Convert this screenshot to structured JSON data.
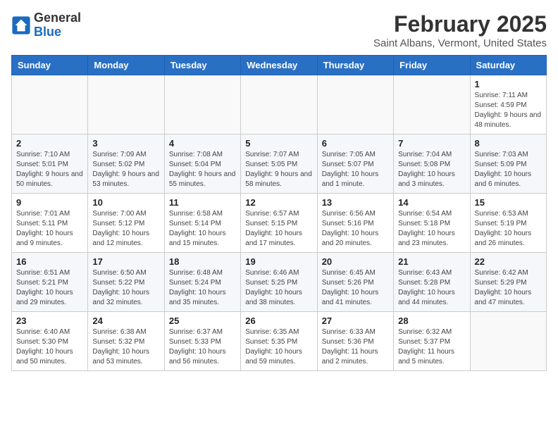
{
  "header": {
    "logo_general": "General",
    "logo_blue": "Blue",
    "title": "February 2025",
    "subtitle": "Saint Albans, Vermont, United States"
  },
  "weekdays": [
    "Sunday",
    "Monday",
    "Tuesday",
    "Wednesday",
    "Thursday",
    "Friday",
    "Saturday"
  ],
  "weeks": [
    [
      {
        "day": "",
        "info": ""
      },
      {
        "day": "",
        "info": ""
      },
      {
        "day": "",
        "info": ""
      },
      {
        "day": "",
        "info": ""
      },
      {
        "day": "",
        "info": ""
      },
      {
        "day": "",
        "info": ""
      },
      {
        "day": "1",
        "info": "Sunrise: 7:11 AM\nSunset: 4:59 PM\nDaylight: 9 hours and 48 minutes."
      }
    ],
    [
      {
        "day": "2",
        "info": "Sunrise: 7:10 AM\nSunset: 5:01 PM\nDaylight: 9 hours and 50 minutes."
      },
      {
        "day": "3",
        "info": "Sunrise: 7:09 AM\nSunset: 5:02 PM\nDaylight: 9 hours and 53 minutes."
      },
      {
        "day": "4",
        "info": "Sunrise: 7:08 AM\nSunset: 5:04 PM\nDaylight: 9 hours and 55 minutes."
      },
      {
        "day": "5",
        "info": "Sunrise: 7:07 AM\nSunset: 5:05 PM\nDaylight: 9 hours and 58 minutes."
      },
      {
        "day": "6",
        "info": "Sunrise: 7:05 AM\nSunset: 5:07 PM\nDaylight: 10 hours and 1 minute."
      },
      {
        "day": "7",
        "info": "Sunrise: 7:04 AM\nSunset: 5:08 PM\nDaylight: 10 hours and 3 minutes."
      },
      {
        "day": "8",
        "info": "Sunrise: 7:03 AM\nSunset: 5:09 PM\nDaylight: 10 hours and 6 minutes."
      }
    ],
    [
      {
        "day": "9",
        "info": "Sunrise: 7:01 AM\nSunset: 5:11 PM\nDaylight: 10 hours and 9 minutes."
      },
      {
        "day": "10",
        "info": "Sunrise: 7:00 AM\nSunset: 5:12 PM\nDaylight: 10 hours and 12 minutes."
      },
      {
        "day": "11",
        "info": "Sunrise: 6:58 AM\nSunset: 5:14 PM\nDaylight: 10 hours and 15 minutes."
      },
      {
        "day": "12",
        "info": "Sunrise: 6:57 AM\nSunset: 5:15 PM\nDaylight: 10 hours and 17 minutes."
      },
      {
        "day": "13",
        "info": "Sunrise: 6:56 AM\nSunset: 5:16 PM\nDaylight: 10 hours and 20 minutes."
      },
      {
        "day": "14",
        "info": "Sunrise: 6:54 AM\nSunset: 5:18 PM\nDaylight: 10 hours and 23 minutes."
      },
      {
        "day": "15",
        "info": "Sunrise: 6:53 AM\nSunset: 5:19 PM\nDaylight: 10 hours and 26 minutes."
      }
    ],
    [
      {
        "day": "16",
        "info": "Sunrise: 6:51 AM\nSunset: 5:21 PM\nDaylight: 10 hours and 29 minutes."
      },
      {
        "day": "17",
        "info": "Sunrise: 6:50 AM\nSunset: 5:22 PM\nDaylight: 10 hours and 32 minutes."
      },
      {
        "day": "18",
        "info": "Sunrise: 6:48 AM\nSunset: 5:24 PM\nDaylight: 10 hours and 35 minutes."
      },
      {
        "day": "19",
        "info": "Sunrise: 6:46 AM\nSunset: 5:25 PM\nDaylight: 10 hours and 38 minutes."
      },
      {
        "day": "20",
        "info": "Sunrise: 6:45 AM\nSunset: 5:26 PM\nDaylight: 10 hours and 41 minutes."
      },
      {
        "day": "21",
        "info": "Sunrise: 6:43 AM\nSunset: 5:28 PM\nDaylight: 10 hours and 44 minutes."
      },
      {
        "day": "22",
        "info": "Sunrise: 6:42 AM\nSunset: 5:29 PM\nDaylight: 10 hours and 47 minutes."
      }
    ],
    [
      {
        "day": "23",
        "info": "Sunrise: 6:40 AM\nSunset: 5:30 PM\nDaylight: 10 hours and 50 minutes."
      },
      {
        "day": "24",
        "info": "Sunrise: 6:38 AM\nSunset: 5:32 PM\nDaylight: 10 hours and 53 minutes."
      },
      {
        "day": "25",
        "info": "Sunrise: 6:37 AM\nSunset: 5:33 PM\nDaylight: 10 hours and 56 minutes."
      },
      {
        "day": "26",
        "info": "Sunrise: 6:35 AM\nSunset: 5:35 PM\nDaylight: 10 hours and 59 minutes."
      },
      {
        "day": "27",
        "info": "Sunrise: 6:33 AM\nSunset: 5:36 PM\nDaylight: 11 hours and 2 minutes."
      },
      {
        "day": "28",
        "info": "Sunrise: 6:32 AM\nSunset: 5:37 PM\nDaylight: 11 hours and 5 minutes."
      },
      {
        "day": "",
        "info": ""
      }
    ]
  ]
}
